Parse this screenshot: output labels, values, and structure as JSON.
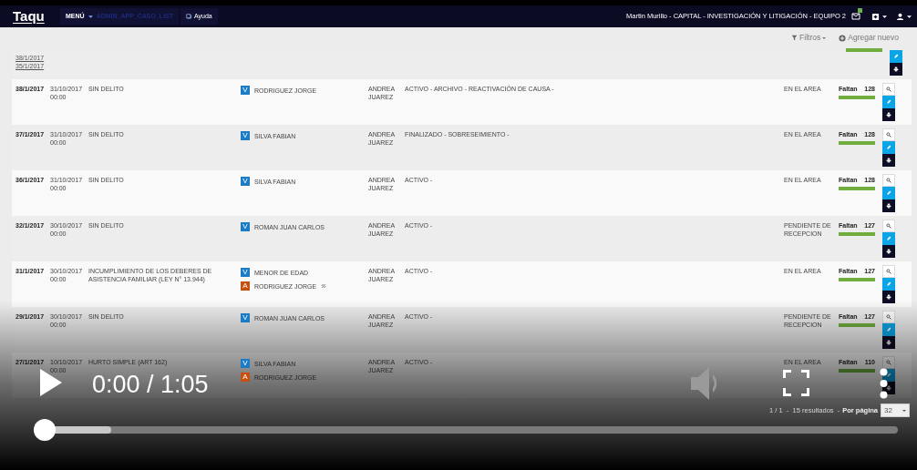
{
  "navbar": {
    "logo": "Taqu",
    "menu": "MENÚ",
    "route": "ADMIN_APP_CASO_LIST",
    "help": "Ayuda",
    "user": "Martin Murillo - CAPITAL - INVESTIGACIÓN Y LITIGACIÓN - EQUIPO 2"
  },
  "toolbar": {
    "filters": "Filtros",
    "add": "Agregar nuevo"
  },
  "partial_row": {
    "links": [
      "38/1/2017",
      "35/1/2017"
    ],
    "level": 1
  },
  "rows": [
    {
      "id": "38/1/2017",
      "date": "31/10/2017",
      "time": "00:00",
      "crime": "SIN DELITO",
      "people": [
        {
          "role": "V",
          "name": "RODRIGUEZ JORGE",
          "color": "#1b7bc4",
          "linked": false
        }
      ],
      "prosecutor": "ANDREA JUAREZ",
      "status": "ACTIVO - ARCHIVO - REACTIVACIÓN DE CAUSA -",
      "location": "EN EL AREA",
      "remaining": "Faltan",
      "days": "128",
      "level": 1
    },
    {
      "id": "37/1/2017",
      "date": "31/10/2017",
      "time": "00:00",
      "crime": "SIN DELITO",
      "people": [
        {
          "role": "V",
          "name": "SILVA FABIAN",
          "color": "#1b7bc4",
          "linked": false
        }
      ],
      "prosecutor": "ANDREA JUAREZ",
      "status": "FINALIZADO - SOBRESEIMIENTO -",
      "location": "EN EL AREA",
      "remaining": "Faltan",
      "days": "128",
      "level": 1
    },
    {
      "id": "36/1/2017",
      "date": "31/10/2017",
      "time": "00:00",
      "crime": "SIN DELITO",
      "people": [
        {
          "role": "V",
          "name": "SILVA FABIAN",
          "color": "#1b7bc4",
          "linked": false
        }
      ],
      "prosecutor": "ANDREA JUAREZ",
      "status": "ACTIVO -",
      "location": "EN EL AREA",
      "remaining": "Faltan",
      "days": "128",
      "level": 1
    },
    {
      "id": "32/1/2017",
      "date": "30/10/2017",
      "time": "00:00",
      "crime": "SIN DELITO",
      "people": [
        {
          "role": "V",
          "name": "ROMAN JUAN CARLOS",
          "color": "#1b7bc4",
          "linked": false
        }
      ],
      "prosecutor": "ANDREA JUAREZ",
      "status": "ACTIVO -",
      "location": "PENDIENTE DE RECEPCION",
      "remaining": "Faltan",
      "days": "127",
      "level": 1
    },
    {
      "id": "31/1/2017",
      "date": "30/10/2017",
      "time": "00:00",
      "crime": "INCUMPLIMIENTO DE LOS DEBERES DE ASISTENCIA FAMILIAR (LEY N° 13.944)",
      "people": [
        {
          "role": "V",
          "name": "MENOR DE EDAD",
          "color": "#1b7bc4",
          "linked": false
        },
        {
          "role": "A",
          "name": "RODRIGUEZ JORGE",
          "color": "#c8500f",
          "linked": true
        }
      ],
      "prosecutor": "ANDREA JUAREZ",
      "status": "ACTIVO -",
      "location": "EN EL AREA",
      "remaining": "Faltan",
      "days": "127",
      "level": 1
    },
    {
      "id": "29/1/2017",
      "date": "30/10/2017",
      "time": "00:00",
      "crime": "SIN DELITO",
      "people": [
        {
          "role": "V",
          "name": "ROMAN JUAN CARLOS",
          "color": "#1b7bc4",
          "linked": false
        }
      ],
      "prosecutor": "ANDREA JUAREZ",
      "status": "ACTIVO -",
      "location": "PENDIENTE DE RECEPCION",
      "remaining": "Faltan",
      "days": "127",
      "level": 1
    },
    {
      "id": "27/1/2017",
      "date": "10/10/2017",
      "time": "00:00",
      "crime": "HURTO SIMPLE (ART 162)",
      "people": [
        {
          "role": "V",
          "name": "SILVA FABIAN",
          "color": "#1b7bc4",
          "linked": false
        },
        {
          "role": "A",
          "name": "RODRIGUEZ JORGE",
          "color": "#c8500f",
          "linked": false
        }
      ],
      "prosecutor": "ANDREA JUAREZ",
      "status": "ACTIVO -",
      "location": "EN EL AREA",
      "remaining": "Faltan",
      "days": "110",
      "level": 1
    }
  ],
  "pagination": {
    "summary": "1 / 1  -  15 resultados  -",
    "per_page_label": "Por página",
    "per_page": "32"
  },
  "player": {
    "time": "0:00 / 1:05",
    "progress": [
      {
        "kind": "buffered",
        "level": 0.09
      },
      {
        "kind": "played",
        "level": 0
      }
    ]
  }
}
